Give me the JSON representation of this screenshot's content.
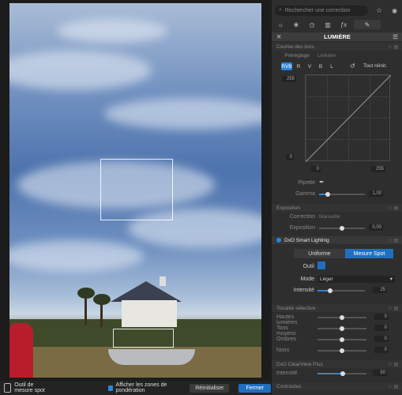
{
  "search": {
    "placeholder": "Rechercher une correction"
  },
  "palette": {
    "title": "LUMIÈRE"
  },
  "tone_curve": {
    "header": "Courbe des tons",
    "preset_label": "Préréglage",
    "preset_value": "Linéaire",
    "channels": [
      "RVB",
      "R",
      "V",
      "B",
      "L"
    ],
    "reset_all": "Tout réinit.",
    "out_top": "255",
    "out_bottom": "0",
    "in_left": "0",
    "in_right": "255",
    "eyedropper_label": "Pipette",
    "gamma_label": "Gamma",
    "gamma_value": "1,00"
  },
  "exposure": {
    "header": "Exposition",
    "correction_label": "Correction",
    "correction_value": "Manuelle",
    "exposure_label": "Exposition",
    "exposure_value": "0,00"
  },
  "smart_lighting": {
    "header": "DxO Smart Lighting",
    "mode_uniform": "Uniforme",
    "mode_spot": "Mesure Spot",
    "tool_label": "Outil",
    "mode_label": "Mode",
    "mode_value": "Léger",
    "intensity_label": "Intensité",
    "intensity_value": "25"
  },
  "selective_tone": {
    "header": "Tonalité sélective",
    "rows": [
      {
        "label": "Hautes lumières",
        "value": "0"
      },
      {
        "label": "Tons moyens",
        "value": "0"
      },
      {
        "label": "Ombres",
        "value": "0"
      },
      {
        "label": "Noirs",
        "value": "0"
      }
    ]
  },
  "clearview": {
    "header": "DxO ClearView Plus",
    "intensity_label": "Intensité",
    "intensity_value": "50"
  },
  "contrast": {
    "header": "Contrastes"
  },
  "bottombar": {
    "tool_name": "Outil de mesure spot",
    "show_zones": "Afficher les zones de pondération",
    "reset": "Réinitialiser",
    "close": "Fermer"
  },
  "colors": {
    "accent": "#2d84d8"
  }
}
